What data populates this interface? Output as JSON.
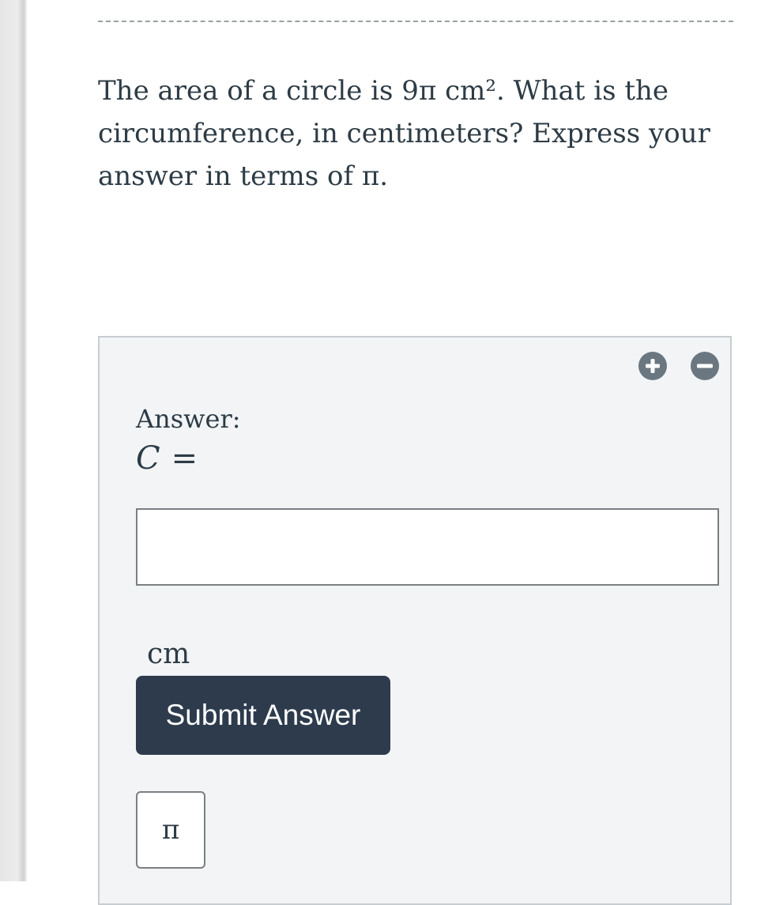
{
  "question": {
    "text": "The area of a circle is 9π cm². What is the circumference, in centimeters? Express your answer in terms of π."
  },
  "answer_panel": {
    "add_icon": "plus-circle-icon",
    "remove_icon": "minus-circle-icon",
    "answer_label": "Answer:",
    "variable": "C",
    "equals": "=",
    "input_value": "",
    "unit": "cm",
    "submit_label": "Submit Answer",
    "pi_button_label": "π"
  },
  "colors": {
    "text": "#2d3b45",
    "submit_bg": "#2d3b4d",
    "panel_bg": "#f2f4f6",
    "icon_button": "#6b7780"
  }
}
